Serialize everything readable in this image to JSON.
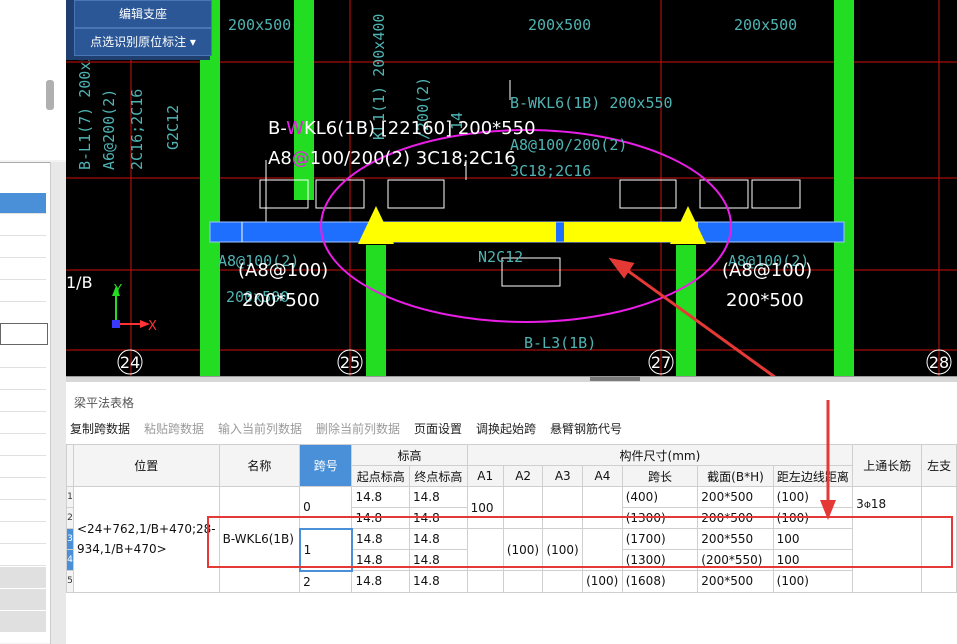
{
  "overlay_buttons": {
    "edit_support": "编辑支座",
    "pick_annotation": "点选识别原位标注",
    "pick_arrow": "▾"
  },
  "cad": {
    "top_labels": [
      "200x500",
      "200x500",
      "200x500"
    ],
    "left_vertical_labels": [
      "B-L1(7) 200x5",
      "A6@200(2)",
      "2C16;2C16",
      "G2C12"
    ],
    "center_vertical_labels": [
      "KL1(1) 200x400",
      "/200(2)",
      "14"
    ],
    "right_beam_labels": [
      "B-WKL6(1B) 200x550",
      "A8@100/200(2)",
      "3C18;2C16"
    ],
    "main_beam_text_1_a": "B-",
    "main_beam_text_1_w": "W",
    "main_beam_text_1_b": "KL6(1B) [22160] 200*550",
    "main_beam_text_2_a": "A8",
    "main_beam_text_2_at": "@",
    "main_beam_text_2_b": "100/200(2) 3C18;2C16",
    "left_support_1": "(A8@100)",
    "left_support_2": "200*500",
    "left_ghost_1": "A8@100(2)",
    "left_ghost_2": "200x500",
    "right_support_1": "(A8@100)",
    "right_support_2": "200*500",
    "right_ghost": "A8@100(2)",
    "mid_label": "N2C12",
    "beam_label": "B-L3(1B)",
    "axis_label": "1/B",
    "axis_x": "X",
    "axis_y": "Y",
    "axis_numbers": [
      "24",
      "25",
      "27",
      "28"
    ],
    "colors": {
      "beam": "#1f6fff",
      "highlight": "#ffff00",
      "column": "#22dd22",
      "grid": "#cc1111",
      "annotation": "#e91ee6",
      "text_cyan": "#4fb3b3"
    }
  },
  "table_panel": {
    "title": "梁平法表格",
    "toolbar": [
      {
        "label": "复制跨数据",
        "enabled": true
      },
      {
        "label": "粘贴跨数据",
        "enabled": false
      },
      {
        "label": "输入当前列数据",
        "enabled": false
      },
      {
        "label": "删除当前列数据",
        "enabled": false
      },
      {
        "label": "页面设置",
        "enabled": true
      },
      {
        "label": "调换起始跨",
        "enabled": true
      },
      {
        "label": "悬臂钢筋代号",
        "enabled": true
      }
    ],
    "headers": {
      "position": "位置",
      "name": "名称",
      "span": "跨号",
      "elevation": "标高",
      "start_elev": "起点标高",
      "end_elev": "终点标高",
      "dimensions": "构件尺寸(mm)",
      "a1": "A1",
      "a2": "A2",
      "a3": "A3",
      "a4": "A4",
      "span_len": "跨长",
      "section": "截面(B*H)",
      "left_dist": "距左边线距离",
      "top_long": "上通长筋",
      "left_support": "左支"
    },
    "position_text": "<24+762,1/B+470;28-934,1/B+470>",
    "name_text": "B-WKL6(1B)",
    "top_long_value_a": "3",
    "top_long_value_sym": "Φ",
    "top_long_value_b": "18",
    "rows": [
      {
        "no": "1",
        "span": "0",
        "start": "14.8",
        "end": "14.8",
        "a1": "100",
        "a2": "",
        "a3": "",
        "a4": "",
        "len": "(400)",
        "section": "200*500",
        "dist": "(100)"
      },
      {
        "no": "2",
        "span": "",
        "start": "14.8",
        "end": "14.8",
        "a1": "",
        "a2": "",
        "a3": "",
        "a4": "",
        "len": "(1300)",
        "section": "200*500",
        "dist": "(100)"
      },
      {
        "no": "3",
        "span": "1",
        "start": "14.8",
        "end": "14.8",
        "a1": "",
        "a2": "(100)",
        "a3": "(100)",
        "a4": "",
        "len": "(1700)",
        "section": "200*550",
        "dist": "100"
      },
      {
        "no": "4",
        "span": "",
        "start": "14.8",
        "end": "14.8",
        "a1": "",
        "a2": "",
        "a3": "",
        "a4": "",
        "len": "(1300)",
        "section": "(200*550)",
        "dist": "100"
      },
      {
        "no": "5",
        "span": "2",
        "start": "14.8",
        "end": "14.8",
        "a1": "",
        "a2": "",
        "a3": "",
        "a4": "(100)",
        "len": "(1608)",
        "section": "200*500",
        "dist": "(100)"
      }
    ]
  }
}
